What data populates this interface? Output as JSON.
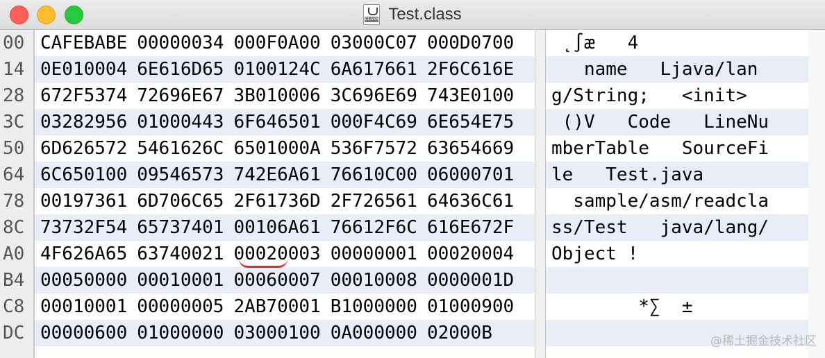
{
  "window": {
    "title": "Test.class",
    "file_icon_tag": "CLASS"
  },
  "offsets": [
    "00",
    "14",
    "28",
    "3C",
    "50",
    "64",
    "78",
    "8C",
    "A0",
    "B4",
    "C8",
    "DC"
  ],
  "hex_rows": [
    [
      "CAFEBABE",
      "00000034",
      "000F0A00",
      "03000C07",
      "000D0700"
    ],
    [
      "0E010004",
      "6E616D65",
      "0100124C",
      "6A617661",
      "2F6C616E"
    ],
    [
      "672F5374",
      "72696E67",
      "3B010006",
      "3C696E69",
      "743E0100"
    ],
    [
      "03282956",
      "01000443",
      "6F646501",
      "000F4C69",
      "6E654E75"
    ],
    [
      "6D626572",
      "5461626C",
      "6501000A",
      "536F7572",
      "63654669"
    ],
    [
      "6C650100",
      "09546573",
      "742E6A61",
      "76610C00",
      "06000701"
    ],
    [
      "00197361",
      "6D706C65",
      "2F61736D",
      "2F726561",
      "64636C61"
    ],
    [
      "73732F54",
      "65737401",
      "00106A61",
      "76612F6C",
      "616E672F"
    ],
    [
      "4F626A65",
      "63740021",
      "00020003",
      "00000001",
      "00020004"
    ],
    [
      "00050000",
      "00010001",
      "00060007",
      "00010008",
      "0000001D"
    ],
    [
      "00010001",
      "00000005",
      "2AB70001",
      "B1000000",
      "01000900"
    ],
    [
      "00000600",
      "01000000",
      "03000100",
      "0A000000",
      "02000B"
    ]
  ],
  "ascii_rows": [
    " ˛∫æ   4",
    "   name   Ljava/lan",
    "g/String;   <init>",
    " ()V   Code   LineNu",
    "mberTable   SourceFi",
    "le   Test.java",
    "  sample/asm/readcla",
    "ss/Test   java/lang/",
    "Object !",
    "",
    "        *∑  ±",
    ""
  ],
  "watermark": "@稀土掘金技术社区",
  "colors": {
    "row_alt": "#e9edf8",
    "annotation": "#e02a1a"
  }
}
